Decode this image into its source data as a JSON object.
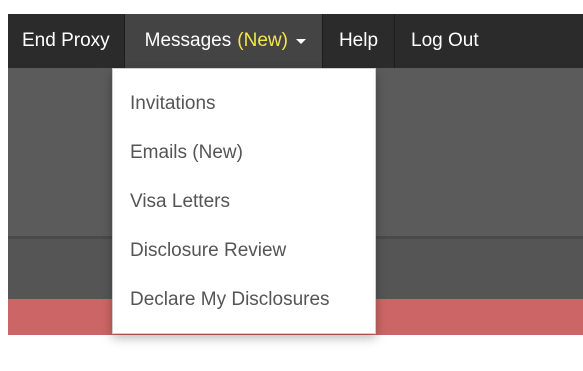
{
  "navbar": {
    "end_proxy": "End Proxy",
    "messages": "Messages",
    "messages_new": "(New)",
    "help": "Help",
    "logout": "Log Out"
  },
  "dropdown": {
    "items": [
      {
        "label": "Invitations"
      },
      {
        "label": "Emails (New)"
      },
      {
        "label": "Visa Letters"
      },
      {
        "label": "Disclosure Review"
      },
      {
        "label": "Declare My Disclosures"
      }
    ]
  },
  "colors": {
    "navbar_bg": "#2b2b2b",
    "active_tab_bg": "#444444",
    "new_badge": "#f4e64a",
    "header_band": "#5b5b5b",
    "accent_stripe": "#cc6666"
  }
}
